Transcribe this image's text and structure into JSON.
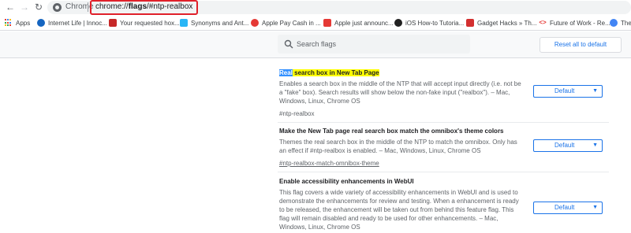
{
  "browser": {
    "site_name": "Chrome",
    "url_scheme": "chrome://",
    "url_host": "flags",
    "url_path": "/#ntp-realbox"
  },
  "bookmarks": [
    {
      "label": "Apps",
      "icon": "apps-grid-icon"
    },
    {
      "label": "Internet Life | Innoc...",
      "icon": "internet-life-icon",
      "color": "#1565c0"
    },
    {
      "label": "Your requested hox...",
      "icon": "article-icon",
      "color": "#c62828"
    },
    {
      "label": "Synonyms and Ant...",
      "icon": "thesaurus-icon",
      "color": "#29b6f6"
    },
    {
      "label": "Apple Pay Cash in ...",
      "icon": "apple-pay-icon",
      "color": "#e53935"
    },
    {
      "label": "Apple just announc...",
      "icon": "apple-news-icon",
      "color": "#e53935"
    },
    {
      "label": "iOS How-to Tutoria...",
      "icon": "ios-howto-icon",
      "color": "#212121"
    },
    {
      "label": "Gadget Hacks » Th...",
      "icon": "gadget-hacks-icon",
      "color": "#d32f2f"
    },
    {
      "label": "Future of Work - Re...",
      "icon": "code-icon",
      "color": "#e53935"
    },
    {
      "label": "The",
      "icon": "google-icon",
      "color": "#4285f4"
    }
  ],
  "search": {
    "placeholder": "Search flags"
  },
  "reset_button": "Reset all to default",
  "flags": [
    {
      "title_selected": "Real",
      "title_rest": " search box in New Tab Page",
      "description": "Enables a search box in the middle of the NTP that will accept input directly (i.e. not be a \"fake\" box). Search results will show below the non-fake input (\"realbox\"). – Mac, Windows, Linux, Chrome OS",
      "link": "#ntp-realbox",
      "value": "Default"
    },
    {
      "title": "Make the New Tab page real search box match the omnibox's theme colors",
      "description": "Themes the real search box in the middle of the NTP to match the omnibox. Only has an effect if #ntp-realbox is enabled. – Mac, Windows, Linux, Chrome OS",
      "link": "#ntp-realbox-match-omnibox-theme",
      "value": "Default"
    },
    {
      "title": "Enable accessibility enhancements in WebUI",
      "description": "This flag covers a wide variety of accessibility enhancements in WebUI and is used to demonstrate the enhancements for review and testing. When a enhancement is ready to be released, the enhancement will be taken out from behind this feature flag. This flag will remain disabled and ready to be used for other enhancements. – Mac, Windows, Linux, Chrome OS",
      "value": "Default"
    }
  ]
}
